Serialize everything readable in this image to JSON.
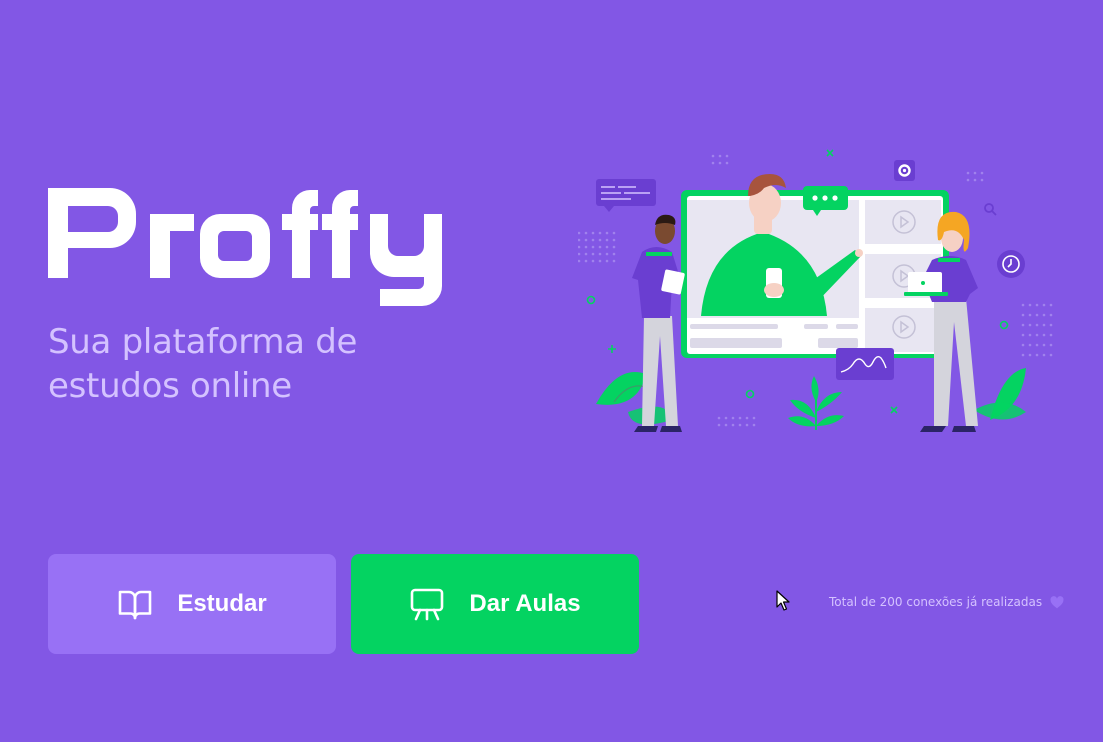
{
  "brand": {
    "name": "Proffy",
    "tagline_line1": "Sua plataforma de",
    "tagline_line2": "estudos online"
  },
  "actions": {
    "study": {
      "label": "Estudar",
      "icon": "book-open-icon"
    },
    "give_classes": {
      "label": "Dar Aulas",
      "icon": "presentation-board-icon"
    }
  },
  "stats": {
    "total_connections_text": "Total de 200 conexões já realizadas",
    "icon": "heart-icon"
  },
  "hero": {
    "illustration": "online-class-illustration"
  },
  "colors": {
    "background": "#8257e5",
    "primary_light": "#9871f5",
    "secondary": "#04d361",
    "text_light": "#d4c2ff",
    "white": "#ffffff"
  }
}
